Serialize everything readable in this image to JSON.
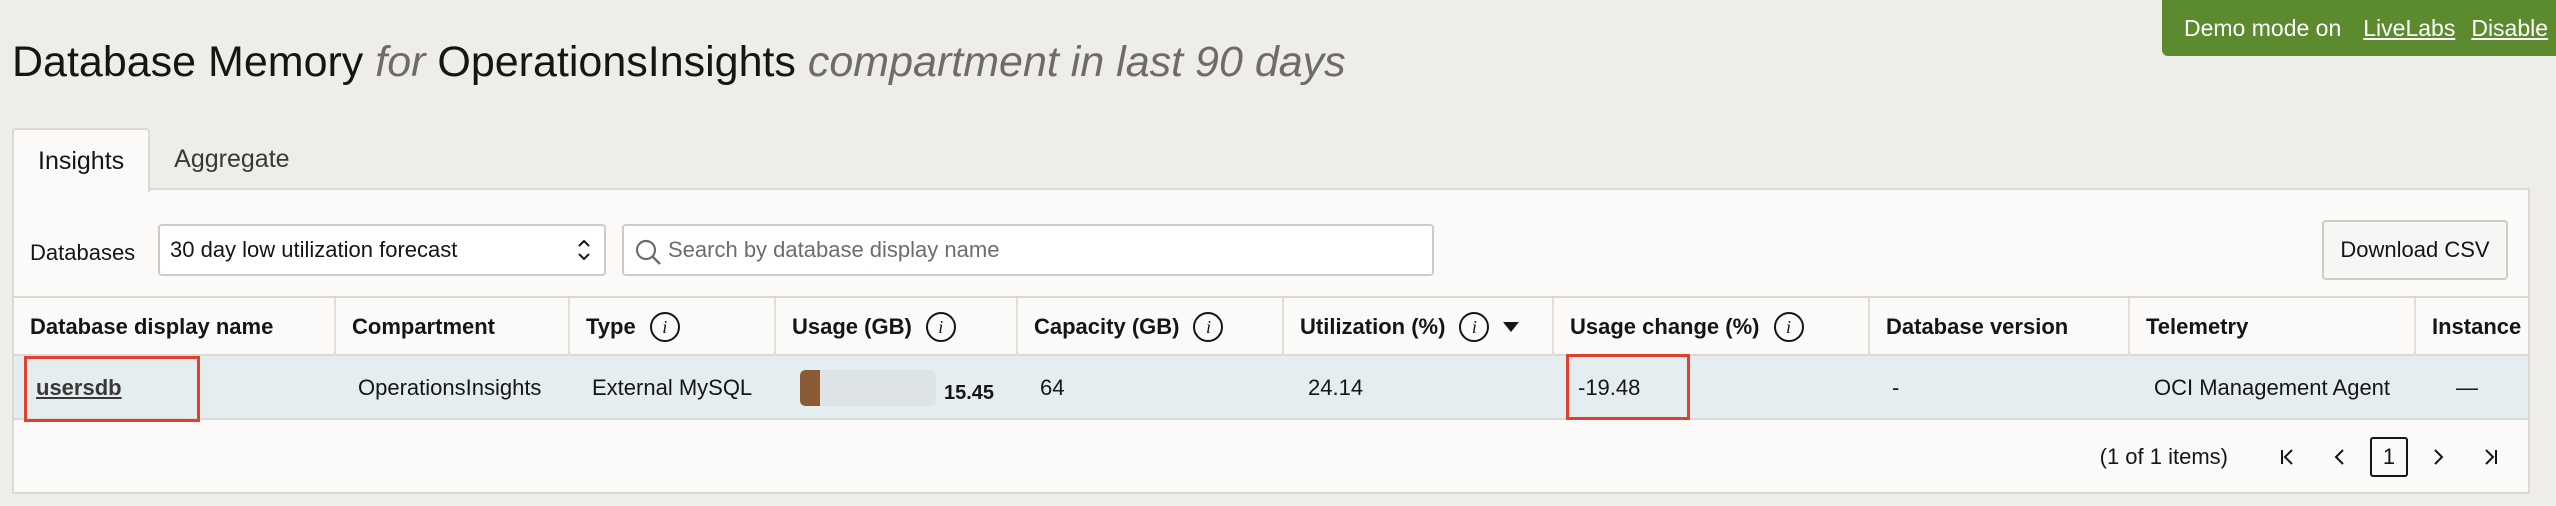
{
  "demo": {
    "text": "Demo mode on",
    "link1": "LiveLabs",
    "link2": "Disable"
  },
  "title": {
    "part1": "Database Memory",
    "part2": "for",
    "part3": "OperationsInsights",
    "part4": "compartment in last 90 days"
  },
  "tabs": [
    {
      "label": "Insights"
    },
    {
      "label": "Aggregate"
    }
  ],
  "toolbar": {
    "databases_label": "Databases",
    "filter_value": "30 day low utilization forecast",
    "search_placeholder": "Search by database display name",
    "download_label": "Download CSV"
  },
  "table": {
    "columns": [
      "Database display name",
      "Compartment",
      "Type",
      "Usage (GB)",
      "Capacity (GB)",
      "Utilization (%)",
      "Usage change (%)",
      "Database version",
      "Telemetry",
      "Instance"
    ],
    "rows": [
      {
        "name": "usersdb",
        "compartment": "OperationsInsights",
        "type": "External MySQL",
        "usage": "15.45",
        "usage_fraction": 0.1445,
        "capacity": "64",
        "utilization": "24.14",
        "usage_change": "-19.48",
        "version": "-",
        "telemetry": "OCI Management Agent",
        "instance": "—"
      }
    ]
  },
  "pager": {
    "count": "(1 of 1 items)",
    "page": "1"
  },
  "colors": {
    "demo_bg": "#5c8a2f",
    "highlight": "#e0412d",
    "usage_fill": "#8a5a34",
    "row_bg": "#e4eef1"
  }
}
